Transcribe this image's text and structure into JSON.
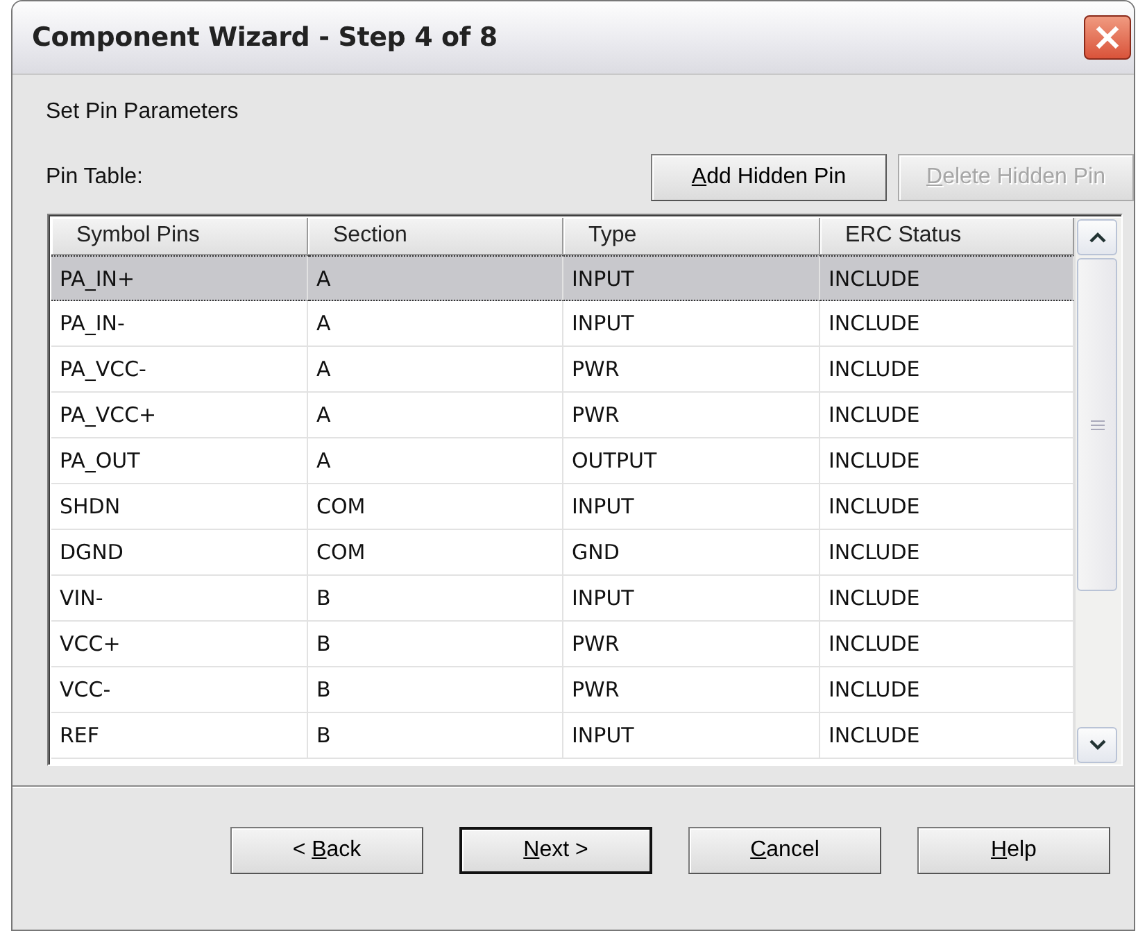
{
  "window": {
    "title": "Component Wizard - Step 4 of 8"
  },
  "heading": "Set Pin Parameters",
  "table_label": "Pin Table:",
  "table_buttons": [
    {
      "key": "A",
      "suffix": "dd Hidden Pin",
      "disabled": false,
      "default": false
    },
    {
      "key": "D",
      "suffix": "elete Hidden Pin",
      "disabled": true,
      "default": false
    }
  ],
  "table": {
    "columns": [
      "Symbol Pins",
      "Section",
      "Type",
      "ERC Status"
    ],
    "rows": [
      {
        "cells": [
          "PA_IN+",
          "A",
          "INPUT",
          "INCLUDE"
        ],
        "selected": true
      },
      {
        "cells": [
          "PA_IN-",
          "A",
          "INPUT",
          "INCLUDE"
        ],
        "selected": false
      },
      {
        "cells": [
          "PA_VCC-",
          "A",
          "PWR",
          "INCLUDE"
        ],
        "selected": false
      },
      {
        "cells": [
          "PA_VCC+",
          "A",
          "PWR",
          "INCLUDE"
        ],
        "selected": false
      },
      {
        "cells": [
          "PA_OUT",
          "A",
          "OUTPUT",
          "INCLUDE"
        ],
        "selected": false
      },
      {
        "cells": [
          "SHDN",
          "COM",
          "INPUT",
          "INCLUDE"
        ],
        "selected": false
      },
      {
        "cells": [
          "DGND",
          "COM",
          "GND",
          "INCLUDE"
        ],
        "selected": false
      },
      {
        "cells": [
          "VIN-",
          "B",
          "INPUT",
          "INCLUDE"
        ],
        "selected": false
      },
      {
        "cells": [
          "VCC+",
          "B",
          "PWR",
          "INCLUDE"
        ],
        "selected": false
      },
      {
        "cells": [
          "VCC-",
          "B",
          "PWR",
          "INCLUDE"
        ],
        "selected": false
      },
      {
        "cells": [
          "REF",
          "B",
          "INPUT",
          "INCLUDE"
        ],
        "selected": false
      }
    ]
  },
  "nav_buttons": [
    {
      "prefix": "< ",
      "key": "B",
      "suffix": "ack",
      "disabled": false,
      "default": false
    },
    {
      "key": "N",
      "suffix": "ext >",
      "disabled": false,
      "default": true
    },
    {
      "key": "C",
      "suffix": "ancel",
      "disabled": false,
      "default": false
    },
    {
      "key": "H",
      "suffix": "elp",
      "disabled": false,
      "default": false
    }
  ]
}
